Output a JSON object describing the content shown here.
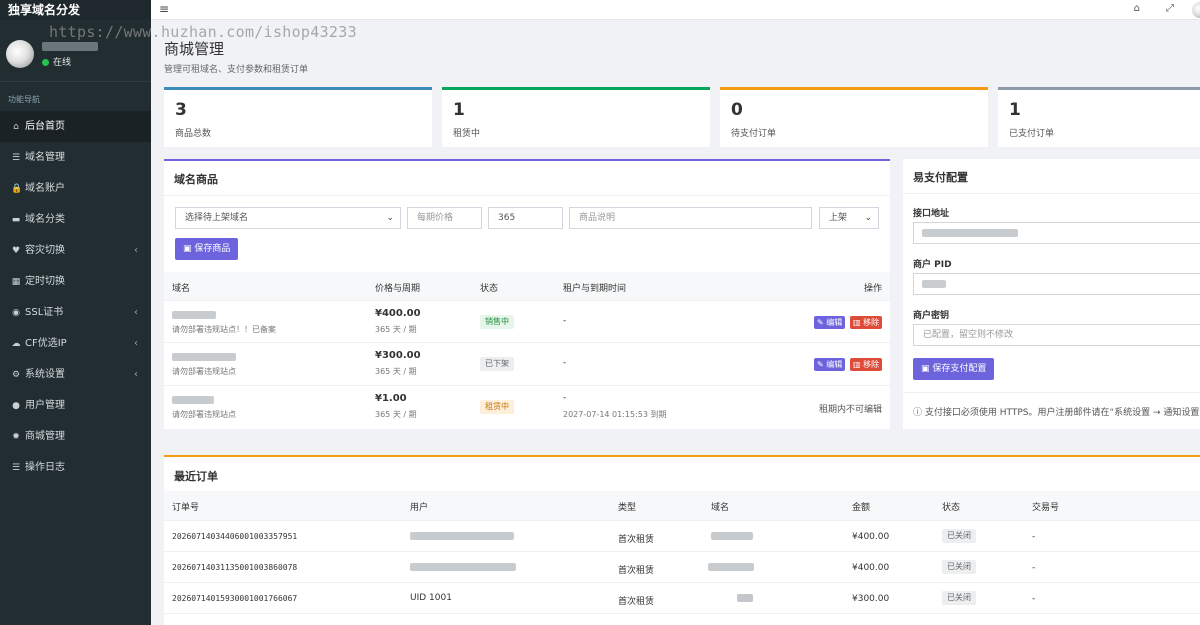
{
  "brand": "独享域名分发",
  "user": {
    "status": "在线"
  },
  "nav": {
    "header": "功能导航",
    "items": [
      {
        "label": "后台首页",
        "icon": "home-icon",
        "glyph": "⌂",
        "chev": ""
      },
      {
        "label": "域名管理",
        "icon": "list-icon",
        "glyph": "☰",
        "chev": ""
      },
      {
        "label": "域名账户",
        "icon": "lock-icon",
        "glyph": "🔒",
        "chev": ""
      },
      {
        "label": "域名分类",
        "icon": "folder-icon",
        "glyph": "▬",
        "chev": ""
      },
      {
        "label": "容灾切换",
        "icon": "heartbeat-icon",
        "glyph": "♥",
        "chev": "‹"
      },
      {
        "label": "定时切换",
        "icon": "calendar-icon",
        "glyph": "▦",
        "chev": ""
      },
      {
        "label": "SSL证书",
        "icon": "shield-icon",
        "glyph": "◉",
        "chev": "‹"
      },
      {
        "label": "CF优选IP",
        "icon": "cloud-icon",
        "glyph": "☁",
        "chev": "‹"
      },
      {
        "label": "系统设置",
        "icon": "gears-icon",
        "glyph": "⚙",
        "chev": "‹"
      },
      {
        "label": "用户管理",
        "icon": "user-icon",
        "glyph": "●",
        "chev": ""
      },
      {
        "label": "商城管理",
        "icon": "gear-icon",
        "glyph": "✹",
        "chev": ""
      },
      {
        "label": "操作日志",
        "icon": "log-icon",
        "glyph": "☰",
        "chev": ""
      }
    ]
  },
  "topbar": {
    "menu_glyph": "≡",
    "home_glyph": "⌂",
    "fullscreen_glyph": "⤢"
  },
  "watermark": "https://www.huzhan.com/ishop43233",
  "page": {
    "title": "商城管理",
    "subtitle": "管理可租域名、支付参数和租赁订单"
  },
  "stats": [
    {
      "value": "3",
      "label": "商品总数",
      "color": "#3c8dbc"
    },
    {
      "value": "1",
      "label": "租赁中",
      "color": "#00a65a"
    },
    {
      "value": "0",
      "label": "待支付订单",
      "color": "#f39c12"
    },
    {
      "value": "1",
      "label": "已支付订单",
      "color": "#8e9aa8"
    }
  ],
  "products": {
    "title": "域名商品",
    "form": {
      "select_domain": "选择待上架域名",
      "price_placeholder": "每期价格",
      "days_value": "365",
      "desc_placeholder": "商品说明",
      "status_value": "上架",
      "save_label": "保存商品"
    },
    "columns": [
      "域名",
      "价格与周期",
      "状态",
      "租户与到期时间",
      "操作"
    ],
    "rows": [
      {
        "note": "请勿部署违规站点！！已备案",
        "price": "¥400.00",
        "period": "365 天 / 期",
        "status": "销售中",
        "tenant": "-",
        "expire": "",
        "edit": "编辑",
        "del": "移除",
        "locked": ""
      },
      {
        "note": "请勿部署违规站点",
        "price": "¥300.00",
        "period": "365 天 / 期",
        "status": "已下架",
        "tenant": "-",
        "expire": "",
        "edit": "编辑",
        "del": "移除",
        "locked": ""
      },
      {
        "note": "请勿部署违规站点",
        "price": "¥1.00",
        "period": "365 天 / 期",
        "status": "租赁中",
        "tenant": "-",
        "expire": "2027-07-14 01:15:53 到期",
        "edit": "",
        "del": "",
        "locked": "租期内不可编辑"
      }
    ]
  },
  "pay": {
    "title": "易支付配置",
    "api_label": "接口地址",
    "pid_label": "商户 PID",
    "key_label": "商户密钥",
    "key_placeholder": "已配置，留空则不修改",
    "save_label": "保存支付配置",
    "note": "ⓘ 支付接口必须使用 HTTPS。用户注册邮件请在“系统设置 → 通知设置”"
  },
  "orders": {
    "title": "最近订单",
    "columns": [
      "订单号",
      "用户",
      "类型",
      "域名",
      "金额",
      "状态",
      "交易号"
    ],
    "rows": [
      {
        "id": "20260714034406001003357951",
        "user": "",
        "type": "首次租赁",
        "amount": "¥400.00",
        "status": "已关闭",
        "trade": "-"
      },
      {
        "id": "20260714031135001003860078",
        "user": "",
        "type": "首次租赁",
        "amount": "¥400.00",
        "status": "已关闭",
        "trade": "-"
      },
      {
        "id": "20260714015930001001766067",
        "user": "UID 1001",
        "type": "首次租赁",
        "amount": "¥300.00",
        "status": "已关闭",
        "trade": "-"
      }
    ]
  }
}
